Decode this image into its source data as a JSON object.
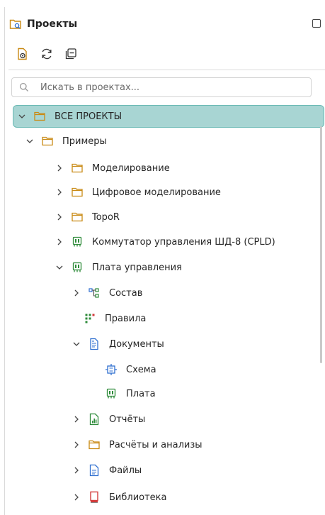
{
  "panel": {
    "title": "Проекты"
  },
  "search": {
    "placeholder": "Искать в проектах..."
  },
  "tree": {
    "root": "ВСЕ ПРОЕКТЫ",
    "examples": "Примеры",
    "modeling": "Моделирование",
    "digital_modeling": "Цифровое моделирование",
    "topor": "TopoR",
    "switch": "Коммутатор управления ШД-8 (CPLD)",
    "control_board": "Плата управления",
    "composition": "Состав",
    "rules": "Правила",
    "documents": "Документы",
    "schema": "Схема",
    "board": "Плата",
    "reports": "Отчёты",
    "calculations": "Расчёты и анализы",
    "files": "Файлы",
    "library": "Библиотека"
  },
  "colors": {
    "selection_bg": "#a8d5d3",
    "selection_border": "#69b9b4",
    "folder": "#c98a14",
    "board_icon": "#2e8b3a",
    "doc_icon": "#2f6fd0",
    "library_icon": "#d23b3b"
  }
}
